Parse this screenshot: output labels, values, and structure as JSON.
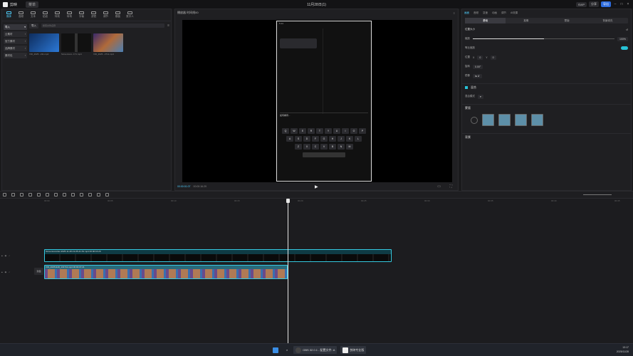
{
  "app": {
    "title": "剪映",
    "project": "11月28日(1)",
    "menu_label": "菜单",
    "right_badges": [
      "SVIP",
      "分享",
      "导出"
    ],
    "accent": "#4fd0ff"
  },
  "media": {
    "tools": [
      "媒体",
      "音频",
      "文本",
      "贴纸",
      "特效",
      "转场",
      "字幕",
      "滤镜",
      "调节",
      "模板",
      "数字人"
    ],
    "side": [
      "导入",
      "云素材",
      "官方素材",
      "品牌素材",
      "素材包"
    ],
    "import_label": "导入",
    "search_placeholder": "搜索文件名称",
    "thumbs": [
      {
        "caption": "VID_2025...211.mp4",
        "color": "#1e4f9a"
      },
      {
        "caption": "Screenreco..171.mp4",
        "color": "#222"
      },
      {
        "caption": "VID_2025...2711.mp4",
        "color": "#6b4a8a"
      }
    ]
  },
  "player": {
    "title": "播放器 时间线00",
    "time_current": "00:00:01:07",
    "time_total": "00:00:16:29",
    "phone": {
      "time": "5:14",
      "input_text": "如何看待...",
      "keys_row1": [
        "Q",
        "W",
        "E",
        "R",
        "T",
        "Y",
        "U",
        "I",
        "O",
        "P"
      ],
      "keys_row2": [
        "A",
        "S",
        "D",
        "F",
        "G",
        "H",
        "J",
        "K",
        "L"
      ],
      "keys_row3": [
        "Z",
        "X",
        "C",
        "V",
        "B",
        "N",
        "M"
      ]
    }
  },
  "inspector": {
    "tabs": [
      "画面",
      "音频",
      "变速",
      "动画",
      "调节",
      "AI效果"
    ],
    "subtabs": [
      "基础",
      "抠像",
      "蒙版",
      "背景填充"
    ],
    "position_size": "位置大小",
    "scale_label": "缩放",
    "scale_value": "100%",
    "scale_fraction": 0.5,
    "uniform_label": "等比缩放",
    "position_label": "位置",
    "pos_x": "0",
    "pos_y": "0",
    "rotate_label": "旋转",
    "rotate_value": "0.00°",
    "mirror_label": "镜像",
    "mix_label": "混合",
    "blend_label": "混合模式",
    "mask_label": "蒙版",
    "bg_label": "背景"
  },
  "timeline": {
    "ruler": [
      "00:00",
      "00:05",
      "00:10",
      "00:15",
      "00:20",
      "00:25",
      "00:30",
      "00:35",
      "00:40",
      "00:45"
    ],
    "cover_label": "封面",
    "clip1_caption": "Screenrecorder-2025-11-28-13-05-21-54.mp4  00:00:16:29",
    "clip2_caption": "VID_20251128_131711.mp4  00:00:07:21"
  },
  "taskbar": {
    "apps": [
      "OBS 32.0.1 - 配置文件: A",
      "剪映专业版"
    ],
    "time": "13:17",
    "date": "2025/11/28"
  }
}
